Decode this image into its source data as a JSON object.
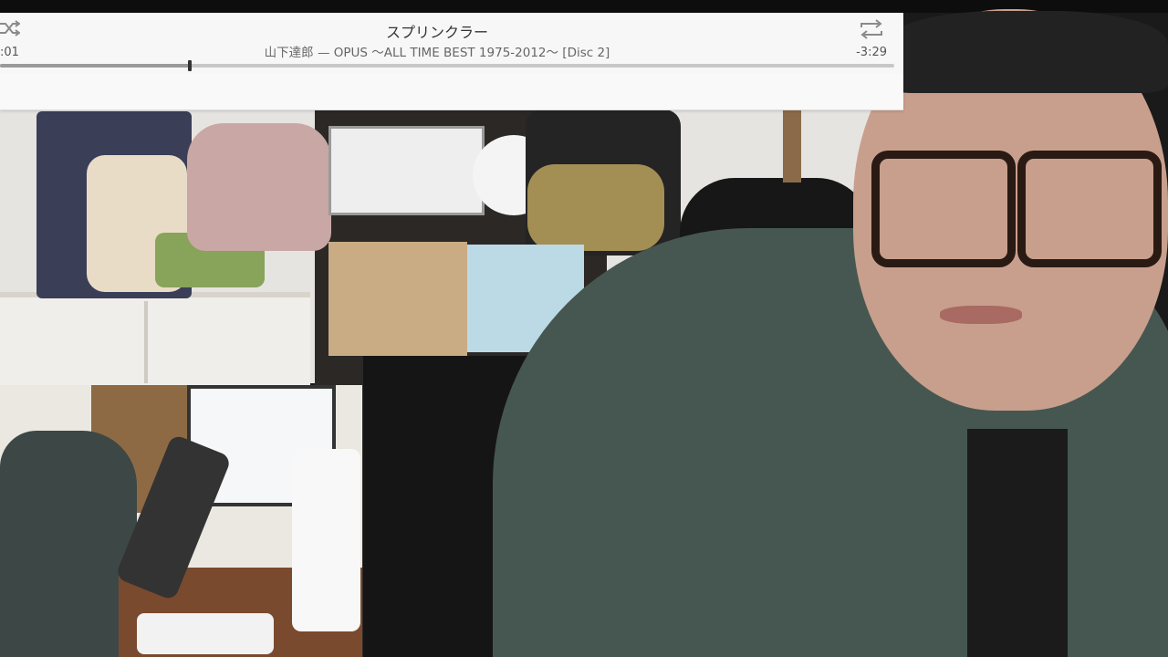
{
  "player": {
    "track_title": "スプリンクラー",
    "track_subtitle": "山下達郎 — OPUS 〜ALL TIME BEST 1975-2012〜 [Disc 2]",
    "elapsed": ":01",
    "remaining": "-3:29",
    "progress_fraction": 0.212,
    "shuffle_icon": "shuffle-icon",
    "repeat_icon": "repeat-icon"
  },
  "colors": {
    "player_bg": "#f7f7f7",
    "text_primary": "#333333",
    "text_secondary": "#666666"
  }
}
